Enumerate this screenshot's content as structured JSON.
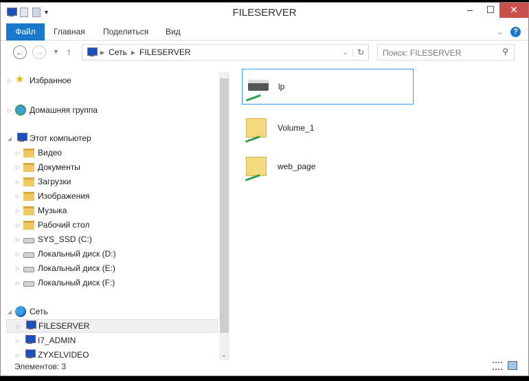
{
  "window": {
    "title": "FILESERVER",
    "minimize": "‒",
    "maximize": "☐",
    "close": "✕"
  },
  "ribbon": {
    "tabs": [
      "Файл",
      "Главная",
      "Поделиться",
      "Вид"
    ],
    "help": "?",
    "expand": "⌄"
  },
  "address": {
    "crumbs": [
      "Сеть",
      "FILESERVER"
    ],
    "search_placeholder": "Поиск: FILESERVER"
  },
  "nav": {
    "favorites": "Избранное",
    "homegroup": "Домашняя группа",
    "computer": "Этот компьютер",
    "computer_items": [
      "Видео",
      "Документы",
      "Загрузки",
      "Изображения",
      "Музыка",
      "Рабочий стол",
      "SYS_SSD (C:)",
      "Локальный диск (D:)",
      "Локальный диск (E:)",
      "Локальный диск (F:)"
    ],
    "network": "Сеть",
    "network_items": [
      "FILESERVER",
      "I7_ADMIN",
      "ZYXELVIDEO"
    ]
  },
  "content": {
    "items": [
      {
        "name": "lp",
        "type": "printer"
      },
      {
        "name": "Volume_1",
        "type": "folder"
      },
      {
        "name": "web_page",
        "type": "folder"
      }
    ]
  },
  "status": {
    "count": "Элементов: 3"
  }
}
